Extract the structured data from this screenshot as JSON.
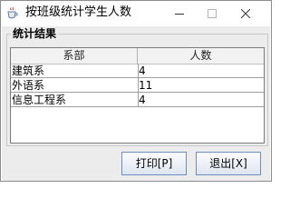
{
  "window": {
    "title": "按班级统计学生人数",
    "icon": "java-cup-icon",
    "controls": [
      "minimize-icon",
      "maximize-icon",
      "close-icon"
    ]
  },
  "group": {
    "title": "统计结果"
  },
  "table": {
    "columns": [
      "系部",
      "人数"
    ],
    "rows": [
      [
        "建筑系",
        "4"
      ],
      [
        "外语系",
        "11"
      ],
      [
        "信息工程系",
        "4"
      ]
    ]
  },
  "buttons": {
    "print_label": "打印[P]",
    "exit_label": "退出[X]"
  },
  "colors": {
    "window_background": "#ececec",
    "button_border": "#6d8dc0",
    "grid_line": "#a0a0a0"
  }
}
